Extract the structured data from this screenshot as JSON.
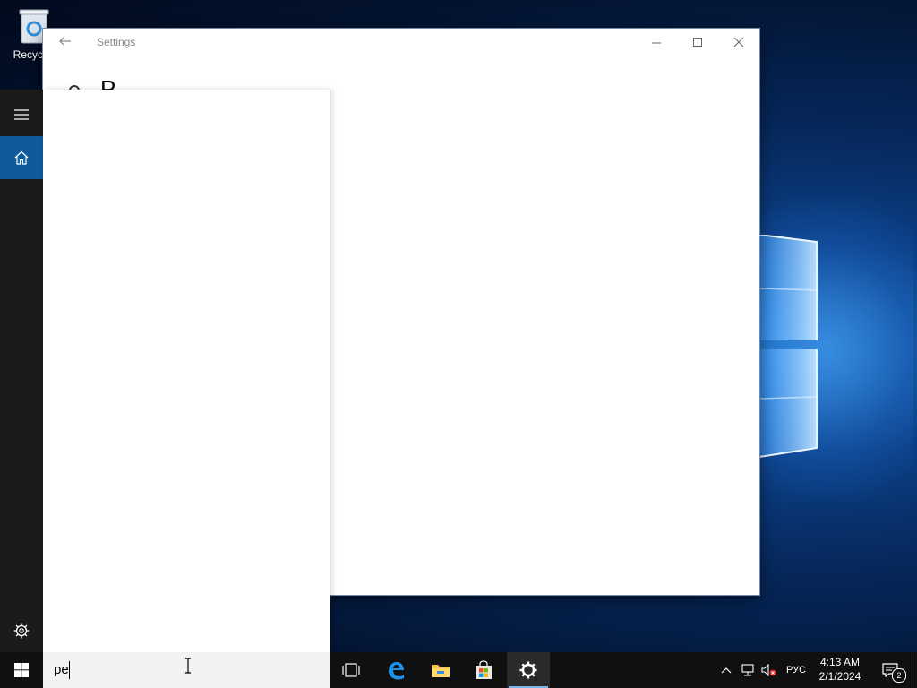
{
  "desktop": {
    "recycle_bin_label": "Recycle"
  },
  "settings_window": {
    "title": "Settings",
    "heading_partial": "Р",
    "controls": {
      "minimize": "minimize",
      "maximize": "maximize",
      "close": "close"
    }
  },
  "nav": {
    "items": [
      {
        "icon": "hamburger-icon",
        "active": false
      },
      {
        "icon": "home-icon",
        "active": true
      },
      {
        "icon": "gear-icon",
        "active": false
      }
    ]
  },
  "search": {
    "query": "pe"
  },
  "taskbar": {
    "pinned": [
      {
        "icon": "task-view-icon",
        "active": false
      },
      {
        "icon": "edge-icon",
        "active": false
      },
      {
        "icon": "file-explorer-icon",
        "active": false
      },
      {
        "icon": "store-icon",
        "active": false
      },
      {
        "icon": "settings-gear-icon",
        "active": true
      }
    ],
    "tray": {
      "language": "РУС",
      "time": "4:13 AM",
      "date": "2/1/2024",
      "notification_count": "2"
    }
  },
  "colors": {
    "accent": "#0f5a9a",
    "taskbar": "#101010",
    "nav_rail": "#1a1a1a",
    "active_indicator": "#7ab4ea"
  }
}
